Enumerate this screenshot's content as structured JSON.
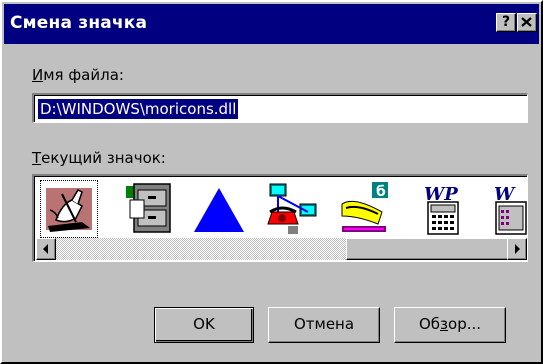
{
  "dialog": {
    "title": "Смена значка",
    "help_button": "?",
    "close_button": "×"
  },
  "file_name": {
    "label_accel": "И",
    "label_rest": "мя файла:",
    "value": "D:\\WINDOWS\\moricons.dll"
  },
  "current_icon": {
    "label_accel": "Т",
    "label_rest": "екущий значок:",
    "icons": [
      "hand-writing-icon",
      "file-cabinet-icon",
      "blue-triangle-icon",
      "telephone-network-icon",
      "fax-icon",
      "wordperfect-calculator-icon",
      "wordperfect-partial-icon"
    ],
    "selected_index": 0
  },
  "buttons": {
    "ok": "OK",
    "cancel": "Отмена",
    "browse_pre": "Об",
    "browse_accel": "з",
    "browse_post": "ор..."
  }
}
